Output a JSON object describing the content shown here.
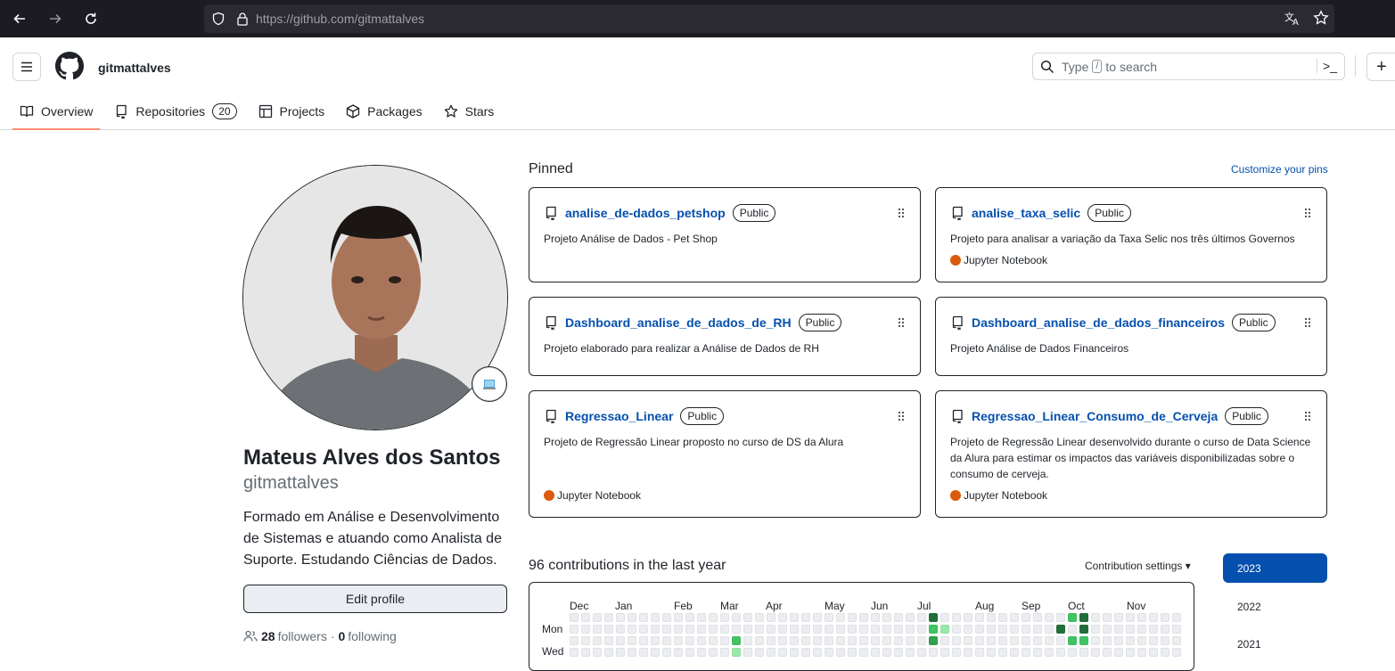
{
  "browser": {
    "url_host": "https://github.com",
    "url_path": "/gitmattalves"
  },
  "header": {
    "username": "gitmattalves",
    "search_placeholder_pre": "Type",
    "search_key": "/",
    "search_placeholder_post": "to search",
    "cmd_glyph": ">_",
    "plus": "+"
  },
  "tabs": [
    {
      "label": "Overview",
      "active": true
    },
    {
      "label": "Repositories",
      "count": "20"
    },
    {
      "label": "Projects"
    },
    {
      "label": "Packages"
    },
    {
      "label": "Stars"
    }
  ],
  "profile": {
    "full_name": "Mateus Alves dos Santos",
    "nickname": "gitmattalves",
    "bio": "Formado em Análise e Desenvolvimento de Sistemas e atuando como Analista de Suporte. Estudando Ciências de Dados.",
    "edit_label": "Edit profile",
    "followers_count": "28",
    "followers_label": "followers",
    "separator": "·",
    "following_count": "0",
    "following_label": "following"
  },
  "pinned": {
    "title": "Pinned",
    "customize_label": "Customize your pins",
    "cards": [
      {
        "name": "analise_de-dados_petshop",
        "visibility": "Public",
        "description": "Projeto Análise de Dados - Pet Shop",
        "language": ""
      },
      {
        "name": "analise_taxa_selic",
        "visibility": "Public",
        "description": "Projeto para analisar a variação da Taxa Selic nos três últimos Governos",
        "language": "Jupyter Notebook"
      },
      {
        "name": "Dashboard_analise_de_dados_de_RH",
        "visibility": "Public",
        "description": "Projeto elaborado para realizar a Análise de Dados de RH",
        "language": ""
      },
      {
        "name": "Dashboard_analise_de_dados_financeiros",
        "visibility": "Public",
        "description": "Projeto Análise de Dados Financeiros",
        "language": ""
      },
      {
        "name": "Regressao_Linear",
        "visibility": "Public",
        "description": "Projeto de Regressão Linear proposto no curso de DS da Alura",
        "language": "Jupyter Notebook"
      },
      {
        "name": "Regressao_Linear_Consumo_de_Cerveja",
        "visibility": "Public",
        "description": "Projeto de Regressão Linear desenvolvido durante o curso de Data Science da Alura para estimar os impactos das variáveis disponibilizadas sobre o consumo de cerveja.",
        "language": "Jupyter Notebook"
      }
    ],
    "language_color": "#DA5B0B"
  },
  "contributions": {
    "title": "96 contributions in the last year",
    "settings_label": "Contribution settings",
    "months": [
      "Dec",
      "Jan",
      "Feb",
      "Mar",
      "Apr",
      "May",
      "Jun",
      "Jul",
      "Aug",
      "Sep",
      "Oct",
      "Nov"
    ],
    "days": [
      "Mon",
      "Wed"
    ],
    "years": [
      "2023",
      "2022",
      "2021"
    ],
    "selected_year": "2023",
    "colors": {
      "empty": "#ebedf0",
      "l1": "#9be9a8",
      "l2": "#40c463",
      "l3": "#30a14e",
      "l4": "#216e39"
    }
  }
}
